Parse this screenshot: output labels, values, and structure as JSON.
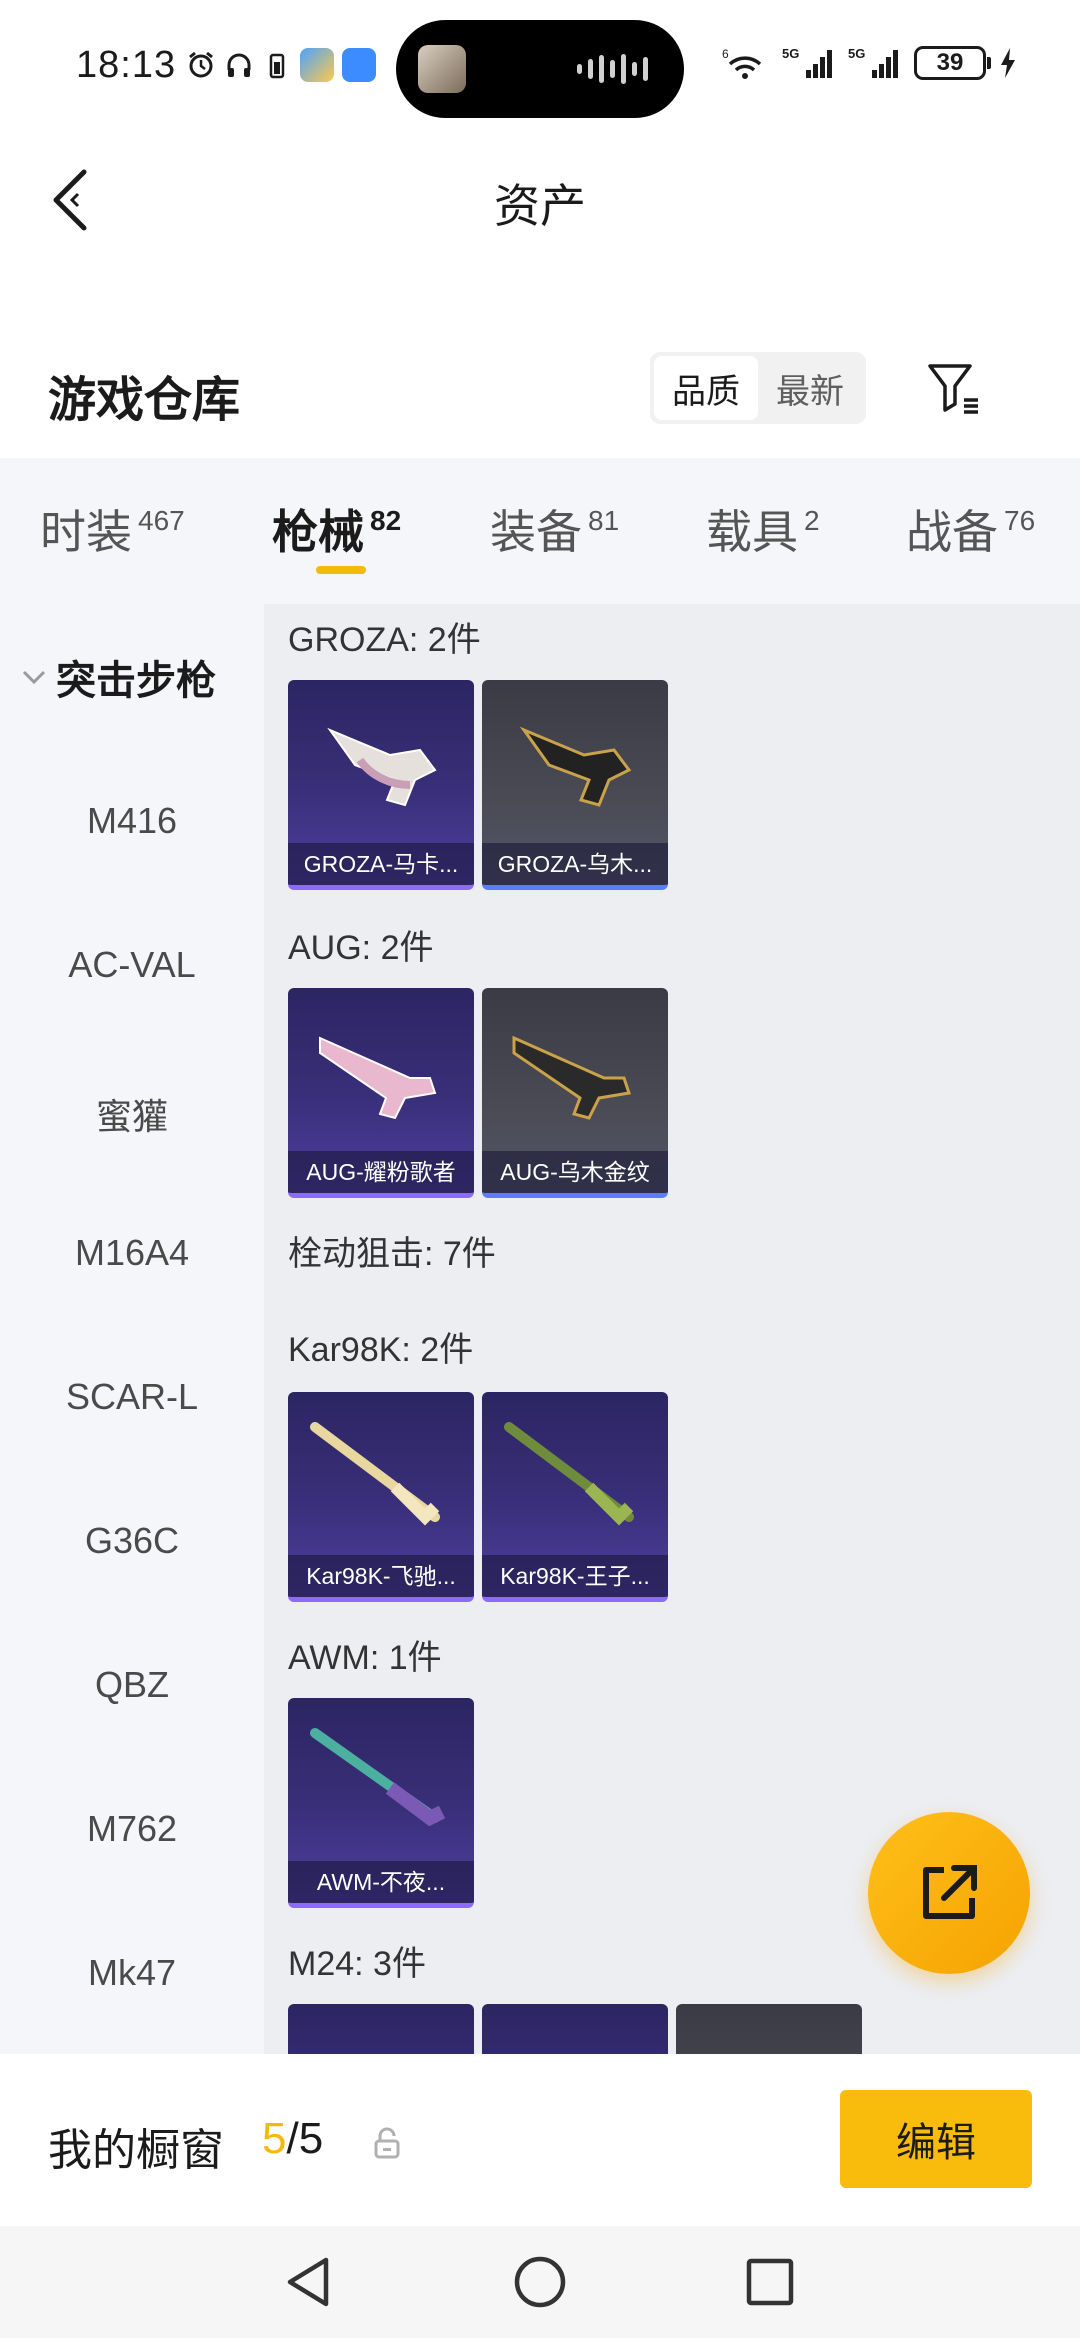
{
  "status_bar": {
    "time": "18:13",
    "battery": "39",
    "signal_labels": [
      "6",
      "5G",
      "5G"
    ]
  },
  "header": {
    "title": "资产"
  },
  "section": {
    "title": "游戏仓库",
    "sort_options": [
      "品质",
      "最新"
    ],
    "active_sort": "品质"
  },
  "tabs": [
    {
      "label": "时装",
      "count": "467"
    },
    {
      "label": "枪械",
      "count": "82"
    },
    {
      "label": "装备",
      "count": "81"
    },
    {
      "label": "载具",
      "count": "2"
    },
    {
      "label": "战备",
      "count": "76"
    }
  ],
  "active_tab": "枪械",
  "side_nav": {
    "category": "突击步枪",
    "items": [
      "M416",
      "AC-VAL",
      "蜜獾",
      "M16A4",
      "SCAR-L",
      "G36C",
      "QBZ",
      "M762",
      "Mk47"
    ]
  },
  "groups": [
    {
      "title": "GROZA: 2件",
      "items": [
        {
          "name": "GROZA-马卡...",
          "rarity": "purple"
        },
        {
          "name": "GROZA-乌木...",
          "rarity": "grey"
        }
      ]
    },
    {
      "title": "AUG: 2件",
      "items": [
        {
          "name": "AUG-耀粉歌者",
          "rarity": "purple"
        },
        {
          "name": "AUG-乌木金纹",
          "rarity": "grey"
        }
      ]
    },
    {
      "title": "栓动狙击: 7件",
      "items": []
    },
    {
      "title": "Kar98K: 2件",
      "items": [
        {
          "name": "Kar98K-飞驰...",
          "rarity": "purple"
        },
        {
          "name": "Kar98K-王子...",
          "rarity": "purple"
        }
      ]
    },
    {
      "title": "AWM: 1件",
      "items": [
        {
          "name": "AWM-不夜...",
          "rarity": "purple"
        }
      ]
    },
    {
      "title": "M24: 3件",
      "items": [
        {
          "name": "",
          "rarity": "purple"
        },
        {
          "name": "",
          "rarity": "purple"
        },
        {
          "name": "",
          "rarity": "grey"
        }
      ]
    }
  ],
  "showcase": {
    "label": "我的橱窗",
    "current": "5",
    "total": "/5",
    "edit_label": "编辑"
  },
  "colors": {
    "accent": "#f9bb0c",
    "purple_card": "#3a2f7a",
    "grey_card": "#4a4b55"
  },
  "icons": [
    "alarm-icon",
    "headphones-icon",
    "weather-icon",
    "message-icon",
    "wifi-icon",
    "signal-icon",
    "back-icon",
    "filter-icon",
    "share-icon",
    "lock-icon",
    "nav-back-icon",
    "nav-home-icon",
    "nav-recents-icon"
  ]
}
